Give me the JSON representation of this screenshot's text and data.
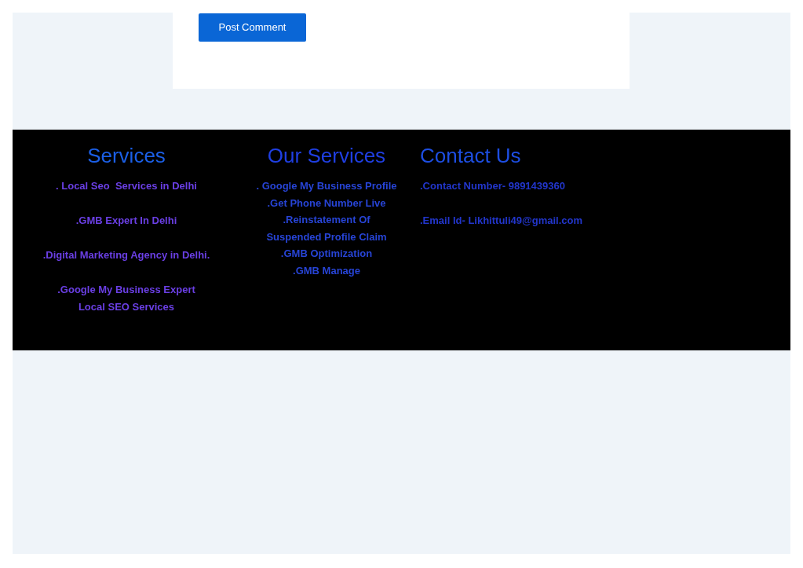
{
  "comment_form": {
    "submit_button": "Post Comment"
  },
  "footer": {
    "columns": [
      {
        "kind": "groups",
        "title": "Services",
        "groups": [
          [
            ". Local Seo  Services in Delhi"
          ],
          [
            ".GMB Expert In Delhi"
          ],
          [
            ".Digital Marketing Agency in Delhi."
          ],
          [
            ".Google My Business Expert",
            "Local SEO Services"
          ]
        ]
      },
      {
        "kind": "list",
        "title": "Our Services",
        "items": [
          ". Google My Business Profile",
          ".Get Phone Number Live",
          ".Reinstatement Of Suspended Profile Claim",
          ".GMB Optimization",
          ".GMB Manage"
        ]
      },
      {
        "kind": "contact",
        "title": "Contact Us",
        "items": [
          ".Contact Number- 9891439360",
          ".Email Id- Likhittuli49@gmail.com"
        ]
      }
    ]
  }
}
